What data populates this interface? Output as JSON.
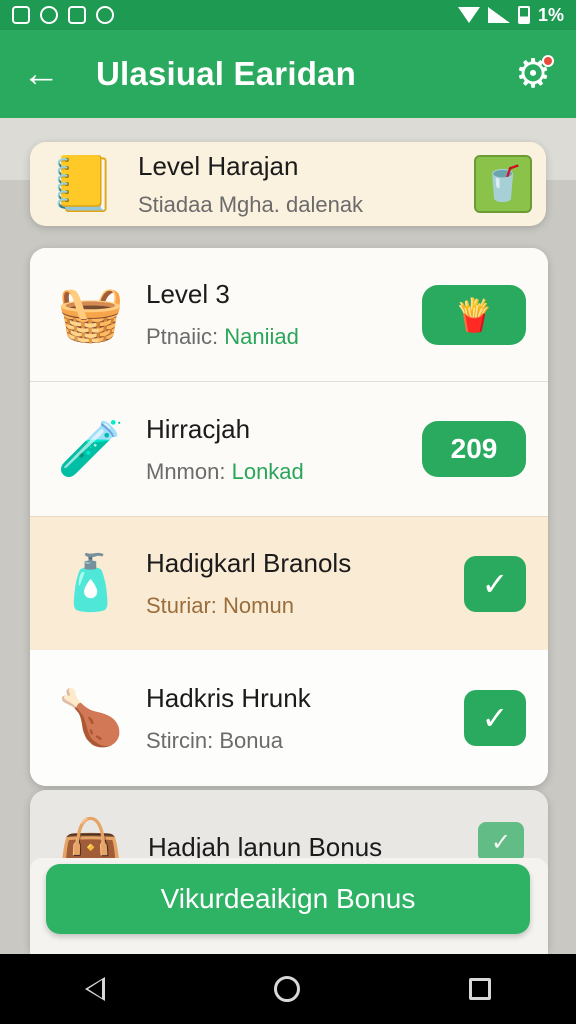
{
  "status_bar": {
    "battery_text": "1%",
    "icons": [
      "notification-icon",
      "sync-icon",
      "image-icon",
      "chat-icon",
      "wifi-icon",
      "signal-icon",
      "battery-icon"
    ]
  },
  "app_bar": {
    "title": "Ulasiual Earidan",
    "back_icon": "back-arrow-icon",
    "settings_icon": "gear-icon"
  },
  "top_card": {
    "title": "Level Harajan",
    "subtitle": "Stiadaa Mgha. dalenak",
    "icon": "book-icon",
    "reward_icon": "gift-box-icon"
  },
  "list": {
    "rows": [
      {
        "title": "Level 3",
        "subtitle_prefix": "Ptnaiic: ",
        "subtitle_value": "Naniiad",
        "icon": "gift-basket-icon",
        "reward_icon": "snack-bundle-icon"
      },
      {
        "title": "Hirracjah",
        "subtitle_prefix": "Mnmon: ",
        "subtitle_value": "Lonkad",
        "icon": "potion-bottle-icon",
        "reward_value": "209"
      },
      {
        "title": "Hadigkarl Branols",
        "subtitle": "Sturiar: Nomun",
        "icon": "oil-bottle-icon",
        "status": "claimed"
      },
      {
        "title": "Hadkris Hrunk",
        "subtitle": "Stircin: Bonua",
        "icon": "drumstick-icon",
        "status": "claimed"
      }
    ]
  },
  "bottom_card": {
    "title": "Hadjah lanun Bonus",
    "icon": "bag-icon",
    "status": "claimed"
  },
  "claim_button": {
    "label": "Vikurdeaikign Bonus"
  },
  "colors": {
    "primary_green": "#2aaa5f",
    "status_green": "#1f9a53",
    "highlight_row": "#faebd4"
  }
}
